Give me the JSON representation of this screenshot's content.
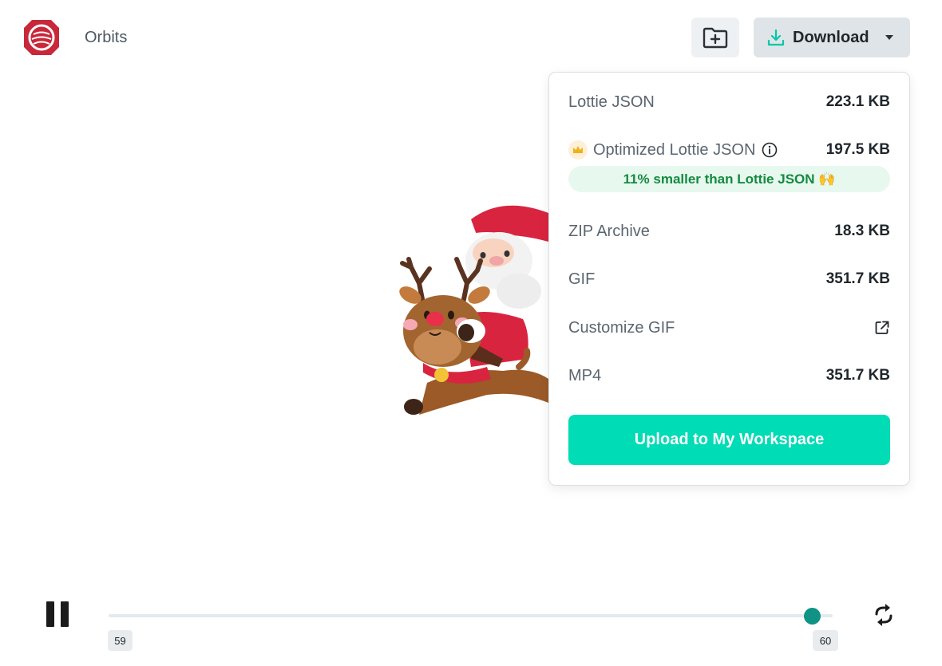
{
  "header": {
    "brand": "Orbits",
    "download_label": "Download"
  },
  "dropdown": {
    "items": [
      {
        "label": "Lottie JSON",
        "size": "223.1 KB"
      },
      {
        "label": "Optimized Lottie JSON",
        "size": "197.5 KB",
        "badge": "11% smaller than Lottie JSON 🙌"
      },
      {
        "label": "ZIP Archive",
        "size": "18.3 KB"
      },
      {
        "label": "GIF",
        "size": "351.7 KB"
      },
      {
        "label": "Customize GIF"
      },
      {
        "label": "MP4",
        "size": "351.7 KB"
      }
    ],
    "upload_label": "Upload to My Workspace"
  },
  "player": {
    "frame_start": "59",
    "frame_end": "60",
    "progress": 0.97
  },
  "icons": {
    "folder": "folder-plus-icon",
    "download": "download-icon",
    "caret": "caret-down-icon",
    "crown": "crown-icon",
    "info": "info-icon",
    "external": "external-link-icon",
    "pause": "pause-icon",
    "loop": "loop-icon"
  },
  "colors": {
    "accent": "#00dcb5",
    "slider_thumb": "#0f9384",
    "badge_bg": "#e7f8ef",
    "badge_text": "#148a3f",
    "download_icon": "#00c9a7",
    "logo": "#c8283a"
  }
}
